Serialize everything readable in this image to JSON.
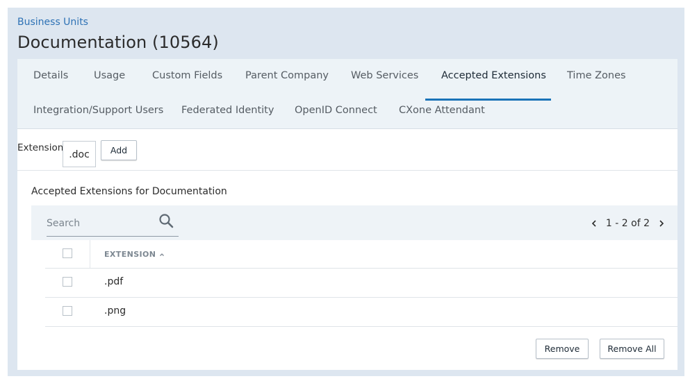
{
  "breadcrumb": "Business Units",
  "page_title": "Documentation (10564)",
  "tabs": [
    {
      "label": "Details"
    },
    {
      "label": "Usage"
    },
    {
      "label": "Custom Fields"
    },
    {
      "label": "Parent Company"
    },
    {
      "label": "Web Services"
    },
    {
      "label": "Accepted Extensions",
      "active": true
    },
    {
      "label": "Time Zones"
    },
    {
      "label": "Integration/Support Users"
    },
    {
      "label": "Federated Identity"
    },
    {
      "label": "OpenID Connect"
    },
    {
      "label": "CXone Attendant"
    }
  ],
  "extension_form": {
    "label": "Extension",
    "value": ".doc",
    "add_label": "Add"
  },
  "section_title": "Accepted Extensions for Documentation",
  "search": {
    "placeholder": "Search"
  },
  "pager": {
    "text": "1 - 2 of 2"
  },
  "table": {
    "column_header": "EXTENSION",
    "rows": [
      ".pdf",
      ".png"
    ]
  },
  "actions": {
    "remove_label": "Remove",
    "remove_all_label": "Remove All"
  },
  "colors": {
    "accent": "#1a73b8",
    "link": "#2e72b5",
    "frame_bg": "#dde6f0",
    "tab_bar_bg": "#edf3f7"
  },
  "icons": [
    "search-icon",
    "chevron-left-icon",
    "chevron-right-icon",
    "sort-ascending-icon"
  ]
}
